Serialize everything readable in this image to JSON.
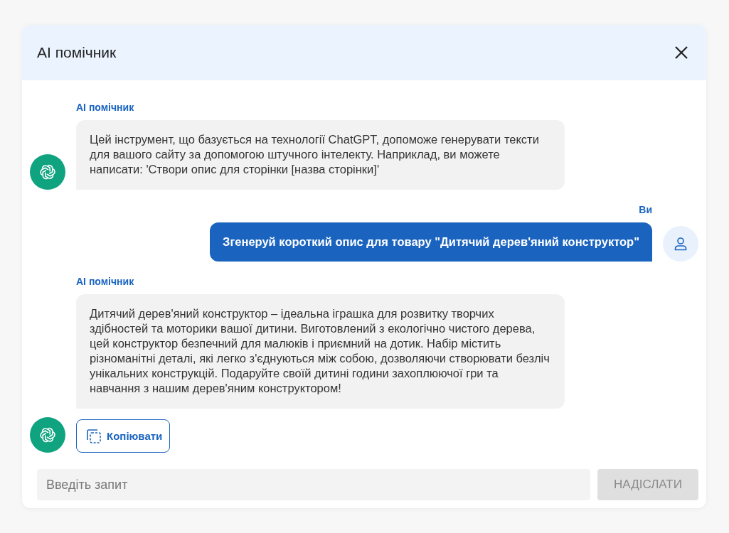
{
  "dialog": {
    "title": "AI помічник"
  },
  "messages": [
    {
      "kind": "assistant",
      "sender": "AI помічник",
      "text": "Цей інструмент, що базується на технології ChatGPT, допоможе генерувати тексти для вашого сайту за допомогою штучного інтелекту. Наприклад, ви можете написати: 'Створи опис для сторінки [назва сторінки]'"
    },
    {
      "kind": "user",
      "sender": "Ви",
      "text": "Згенеруй короткий опис для товару \"Дитячий дерев'яний конструктор\""
    },
    {
      "kind": "assistant",
      "sender": "AI помічник",
      "text": "Дитячий дерев'яний конструктор – ідеальна іграшка для розвитку творчих здібностей та моторики вашої дитини. Виготовлений з екологічно чистого дерева, цей конструктор безпечний для малюків і приємний на дотик. Набір містить різноманітні деталі, які легко з'єднуються між собою, дозволяючи створювати безліч унікальних конструкцій. Подаруйте своїй дитині години захоплюючої гри та навчання з нашим дерев'яним конструктором!",
      "copy_label": "Копіювати"
    }
  ],
  "composer": {
    "placeholder": "Введіть запит",
    "send_label": "НАДІСЛАТИ",
    "send_disabled": true
  }
}
